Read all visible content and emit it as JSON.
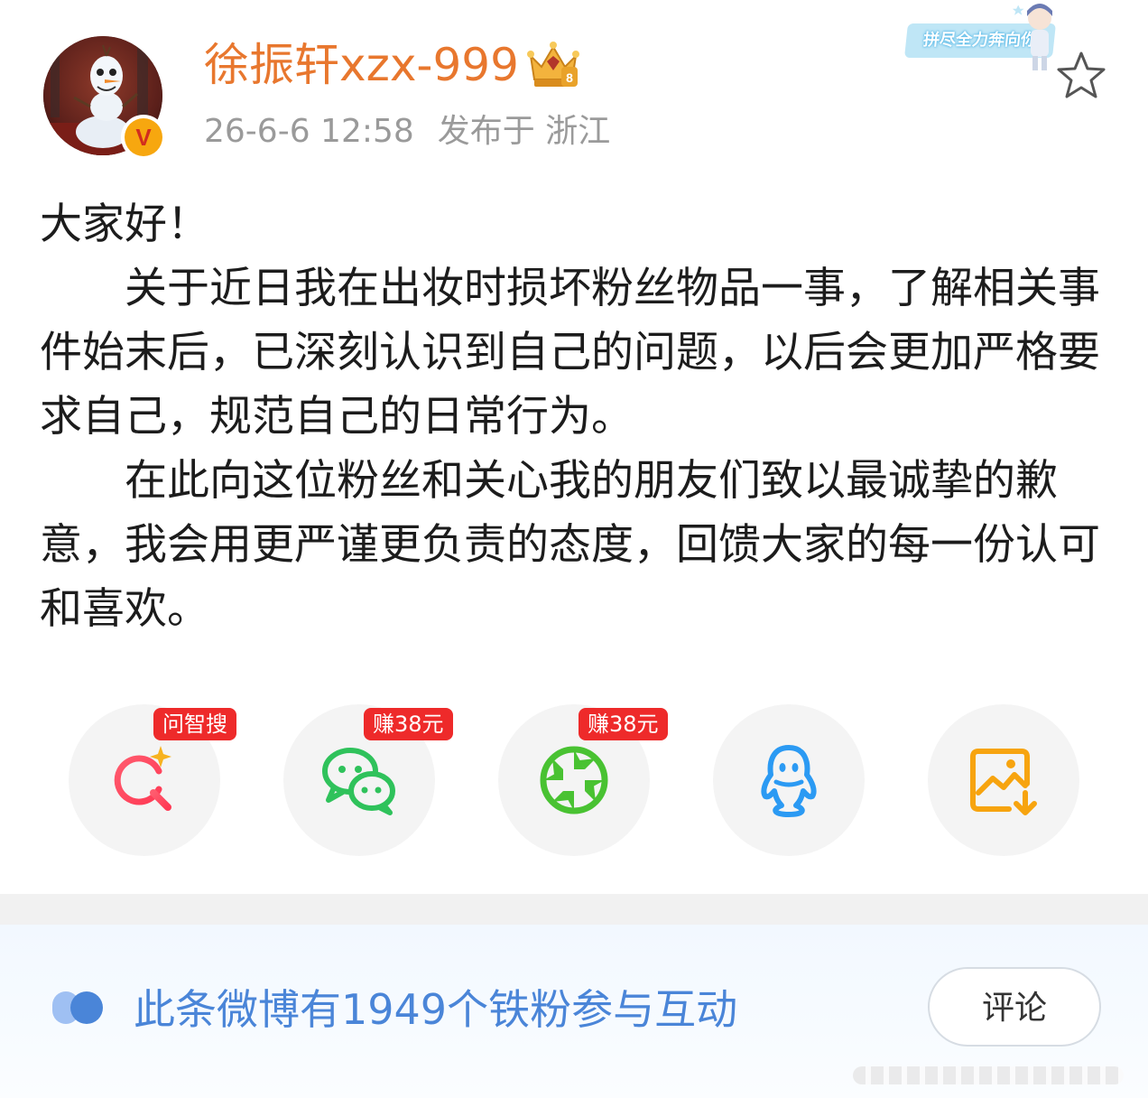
{
  "post": {
    "author": {
      "name": "徐振轩xzx-999",
      "verified_badge": "V",
      "level_badge_number": "8"
    },
    "timestamp": "26-6-6 12:58",
    "location": "发布于 浙江",
    "decoration_text": "拼尽全力奔向你",
    "body": {
      "greeting": "大家好！",
      "paragraph1": "关于近日我在出妆时损坏粉丝物品一事，了解相关事件始末后，已深刻认识到自己的问题，以后会更加严格要求自己，规范自己的日常行为。",
      "paragraph2": "在此向这位粉丝和关心我的朋友们致以最诚挚的歉意，我会用更严谨更负责的态度，回馈大家的每一份认可和喜欢。"
    }
  },
  "share": {
    "items": [
      {
        "icon": "ai-search-icon",
        "badge": "问智搜"
      },
      {
        "icon": "wechat-icon",
        "badge": "赚38元"
      },
      {
        "icon": "moments-icon",
        "badge": "赚38元"
      },
      {
        "icon": "qq-icon",
        "badge": ""
      },
      {
        "icon": "save-image-icon",
        "badge": ""
      }
    ]
  },
  "fans": {
    "text": "此条微博有1949个铁粉参与互动",
    "comment_label": "评论"
  },
  "colors": {
    "username": "#e8772e",
    "fan_text": "#4a85d8",
    "badge_red": "#ee2a2a",
    "wechat_green": "#2fc25b",
    "qq_blue": "#2b9af3",
    "save_orange": "#f7a40f"
  }
}
